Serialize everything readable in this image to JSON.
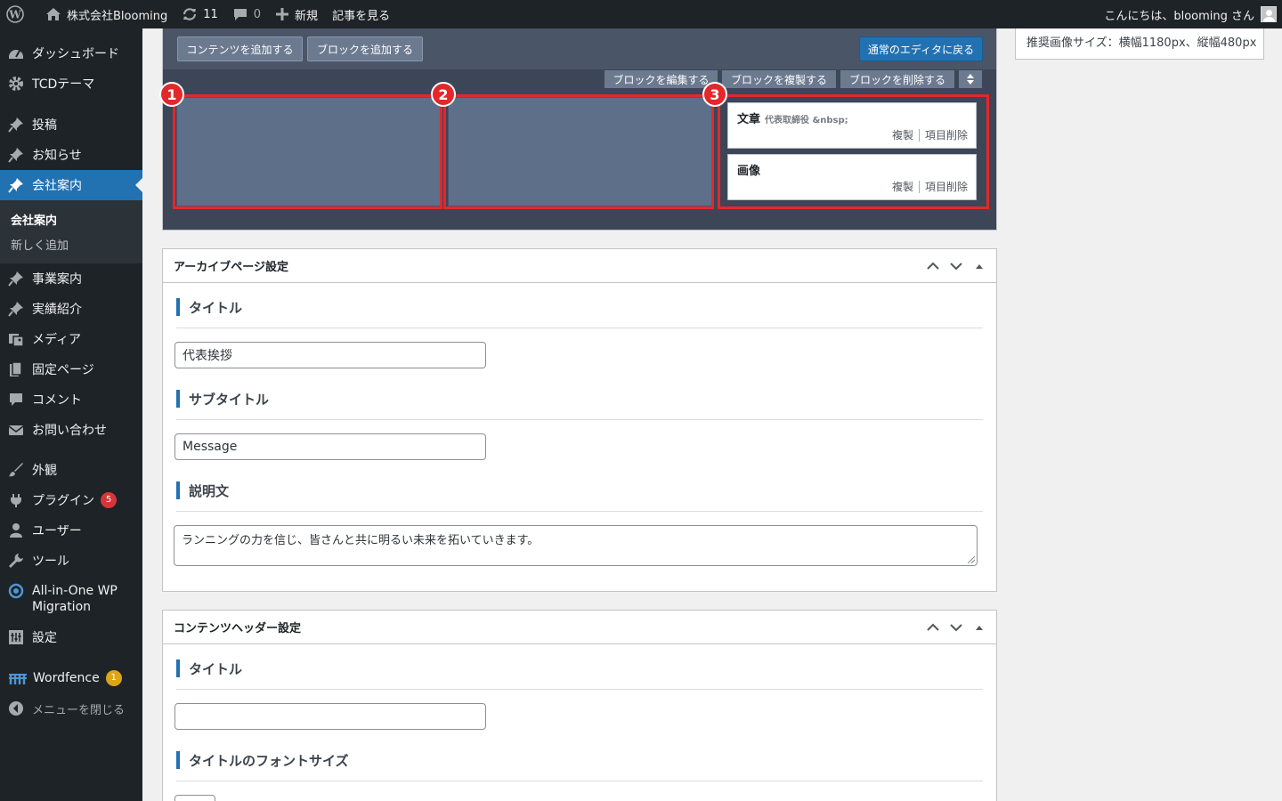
{
  "admin_bar": {
    "site_name": "株式会社Blooming",
    "updates_count": "11",
    "comments_count": "0",
    "new_label": "新規",
    "view_post_label": "記事を見る",
    "greeting": "こんにちは、blooming さん"
  },
  "sidebar": {
    "items": [
      {
        "label": "ダッシュボード",
        "icon": "dashboard-icon"
      },
      {
        "label": "TCDテーマ",
        "icon": "gear-icon"
      },
      {
        "label": "投稿",
        "icon": "pin-icon"
      },
      {
        "label": "お知らせ",
        "icon": "pin-icon"
      },
      {
        "label": "会社案内",
        "icon": "pin-icon"
      },
      {
        "label": "事業案内",
        "icon": "pin-icon"
      },
      {
        "label": "実績紹介",
        "icon": "pin-icon"
      },
      {
        "label": "メディア",
        "icon": "media-icon"
      },
      {
        "label": "固定ページ",
        "icon": "page-icon"
      },
      {
        "label": "コメント",
        "icon": "comment-icon"
      },
      {
        "label": "お問い合わせ",
        "icon": "mail-icon"
      },
      {
        "label": "外観",
        "icon": "brush-icon"
      },
      {
        "label": "プラグイン",
        "icon": "plugin-icon",
        "badge": "5"
      },
      {
        "label": "ユーザー",
        "icon": "user-icon"
      },
      {
        "label": "ツール",
        "icon": "wrench-icon"
      },
      {
        "label": "All-in-One WP",
        "label2": "Migration",
        "icon": "migration-icon"
      },
      {
        "label": "設定",
        "icon": "settings-icon"
      },
      {
        "label": "Wordfence",
        "icon": "wordfence-icon",
        "badge": "1"
      },
      {
        "label": "メニューを閉じる",
        "icon": "collapse-icon"
      }
    ],
    "submenu": {
      "current": "会社案内",
      "add_new": "新しく追加"
    }
  },
  "builder": {
    "add_content": "コンテンツを追加する",
    "add_block": "ブロックを追加する",
    "back_to_editor": "通常のエディタに戻る",
    "edit_block": "ブロックを編集する",
    "duplicate_block": "ブロックを複製する",
    "delete_block": "ブロックを削除する",
    "columns": [
      "1",
      "2",
      "3"
    ],
    "items": [
      {
        "title": "文章",
        "subtitle": "代表取締役 &nbsp;",
        "duplicate": "複製",
        "delete": "項目削除"
      },
      {
        "title": "画像",
        "subtitle": "",
        "duplicate": "複製",
        "delete": "項目削除"
      }
    ]
  },
  "side_info": {
    "text": "推奨画像サイズ：横幅1180px、縦幅480px"
  },
  "archive_box": {
    "title": "アーカイブページ設定",
    "fields": {
      "title_label": "タイトル",
      "title_value": "代表挨拶",
      "subtitle_label": "サブタイトル",
      "subtitle_value": "Message",
      "description_label": "説明文",
      "description_value": "ランニングの力を信じ、皆さんと共に明るい未来を拓いていきます。"
    }
  },
  "header_box": {
    "title": "コンテンツヘッダー設定",
    "fields": {
      "title_label": "タイトル",
      "title_value": "",
      "font_size_label": "タイトルのフォントサイズ"
    }
  },
  "colors": {
    "admin_bg": "#1d2327",
    "accent": "#2271b1",
    "highlight_frame": "#e2282b",
    "builder_bg": "#3c4657"
  }
}
